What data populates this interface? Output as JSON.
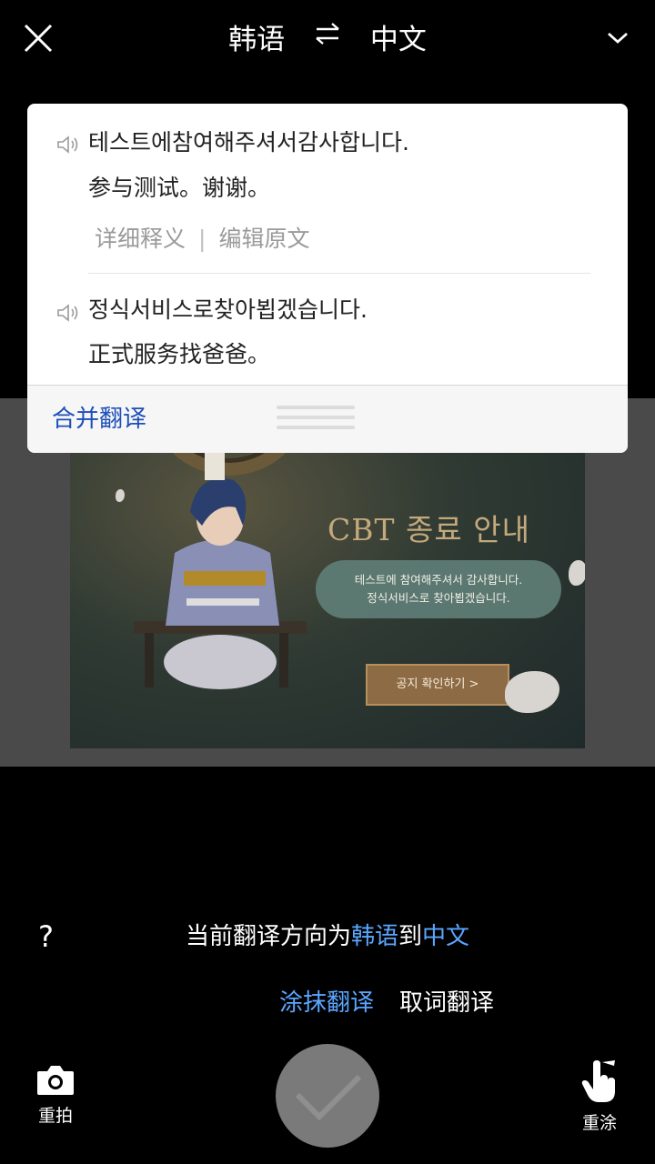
{
  "header": {
    "source_lang": "韩语",
    "target_lang": "中文"
  },
  "image": {
    "banner_title": "CBT 종료 안내",
    "banner_line1": "테스트에 참여해주셔서 감사합니다.",
    "banner_line2": "정식서비스로 찾아뵙겠습니다.",
    "banner_button": "공지 확인하기 >"
  },
  "popup": {
    "entries": [
      {
        "source": "테스트에참여해주셔서감사합니다.",
        "translation": "参与测试。谢谢。",
        "detail_link": "详细释义",
        "separator": "|",
        "edit_link": "编辑原文"
      },
      {
        "source": "정식서비스로찾아뵙겠습니다.",
        "translation": "正式服务找爸爸。"
      }
    ],
    "merge_label": "合并翻译"
  },
  "bottom": {
    "help": "?",
    "direction_prefix": "当前翻译方向为",
    "direction_source": "韩语",
    "direction_mid": "到",
    "direction_target": "中文",
    "mode_smear": "涂抹翻译",
    "mode_word": "取词翻译",
    "retake_label": "重拍",
    "redraw_label": "重涂"
  },
  "colors": {
    "accent": "#5aa6ff",
    "link_blue": "#1d4fb8",
    "background": "#000000"
  },
  "icons": [
    "close-icon",
    "swap-icon",
    "chevron-down-icon",
    "speaker-icon",
    "camera-icon",
    "checkmark-icon",
    "hand-pointer-icon"
  ]
}
